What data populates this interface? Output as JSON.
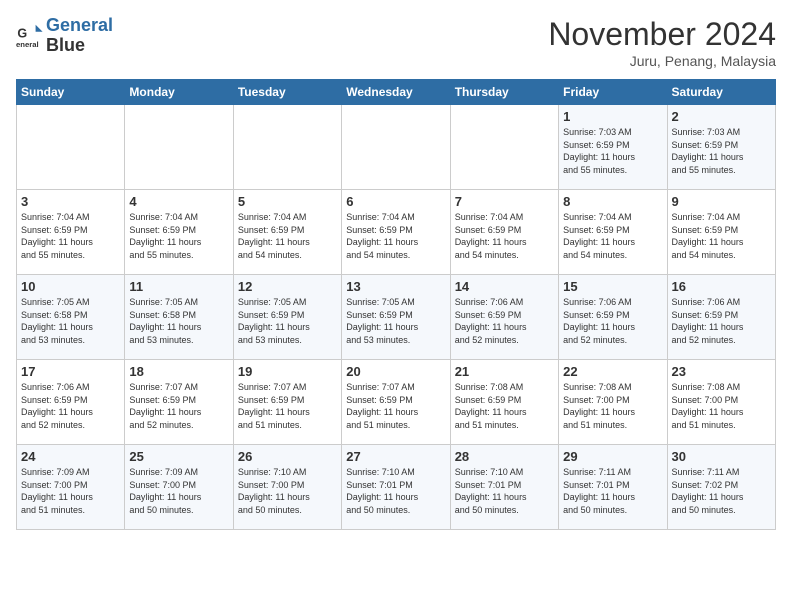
{
  "header": {
    "logo_line1": "General",
    "logo_line2": "Blue",
    "month": "November 2024",
    "location": "Juru, Penang, Malaysia"
  },
  "days_of_week": [
    "Sunday",
    "Monday",
    "Tuesday",
    "Wednesday",
    "Thursday",
    "Friday",
    "Saturday"
  ],
  "weeks": [
    [
      {
        "day": "",
        "info": ""
      },
      {
        "day": "",
        "info": ""
      },
      {
        "day": "",
        "info": ""
      },
      {
        "day": "",
        "info": ""
      },
      {
        "day": "",
        "info": ""
      },
      {
        "day": "1",
        "info": "Sunrise: 7:03 AM\nSunset: 6:59 PM\nDaylight: 11 hours\nand 55 minutes."
      },
      {
        "day": "2",
        "info": "Sunrise: 7:03 AM\nSunset: 6:59 PM\nDaylight: 11 hours\nand 55 minutes."
      }
    ],
    [
      {
        "day": "3",
        "info": "Sunrise: 7:04 AM\nSunset: 6:59 PM\nDaylight: 11 hours\nand 55 minutes."
      },
      {
        "day": "4",
        "info": "Sunrise: 7:04 AM\nSunset: 6:59 PM\nDaylight: 11 hours\nand 55 minutes."
      },
      {
        "day": "5",
        "info": "Sunrise: 7:04 AM\nSunset: 6:59 PM\nDaylight: 11 hours\nand 54 minutes."
      },
      {
        "day": "6",
        "info": "Sunrise: 7:04 AM\nSunset: 6:59 PM\nDaylight: 11 hours\nand 54 minutes."
      },
      {
        "day": "7",
        "info": "Sunrise: 7:04 AM\nSunset: 6:59 PM\nDaylight: 11 hours\nand 54 minutes."
      },
      {
        "day": "8",
        "info": "Sunrise: 7:04 AM\nSunset: 6:59 PM\nDaylight: 11 hours\nand 54 minutes."
      },
      {
        "day": "9",
        "info": "Sunrise: 7:04 AM\nSunset: 6:59 PM\nDaylight: 11 hours\nand 54 minutes."
      }
    ],
    [
      {
        "day": "10",
        "info": "Sunrise: 7:05 AM\nSunset: 6:58 PM\nDaylight: 11 hours\nand 53 minutes."
      },
      {
        "day": "11",
        "info": "Sunrise: 7:05 AM\nSunset: 6:58 PM\nDaylight: 11 hours\nand 53 minutes."
      },
      {
        "day": "12",
        "info": "Sunrise: 7:05 AM\nSunset: 6:59 PM\nDaylight: 11 hours\nand 53 minutes."
      },
      {
        "day": "13",
        "info": "Sunrise: 7:05 AM\nSunset: 6:59 PM\nDaylight: 11 hours\nand 53 minutes."
      },
      {
        "day": "14",
        "info": "Sunrise: 7:06 AM\nSunset: 6:59 PM\nDaylight: 11 hours\nand 52 minutes."
      },
      {
        "day": "15",
        "info": "Sunrise: 7:06 AM\nSunset: 6:59 PM\nDaylight: 11 hours\nand 52 minutes."
      },
      {
        "day": "16",
        "info": "Sunrise: 7:06 AM\nSunset: 6:59 PM\nDaylight: 11 hours\nand 52 minutes."
      }
    ],
    [
      {
        "day": "17",
        "info": "Sunrise: 7:06 AM\nSunset: 6:59 PM\nDaylight: 11 hours\nand 52 minutes."
      },
      {
        "day": "18",
        "info": "Sunrise: 7:07 AM\nSunset: 6:59 PM\nDaylight: 11 hours\nand 52 minutes."
      },
      {
        "day": "19",
        "info": "Sunrise: 7:07 AM\nSunset: 6:59 PM\nDaylight: 11 hours\nand 51 minutes."
      },
      {
        "day": "20",
        "info": "Sunrise: 7:07 AM\nSunset: 6:59 PM\nDaylight: 11 hours\nand 51 minutes."
      },
      {
        "day": "21",
        "info": "Sunrise: 7:08 AM\nSunset: 6:59 PM\nDaylight: 11 hours\nand 51 minutes."
      },
      {
        "day": "22",
        "info": "Sunrise: 7:08 AM\nSunset: 7:00 PM\nDaylight: 11 hours\nand 51 minutes."
      },
      {
        "day": "23",
        "info": "Sunrise: 7:08 AM\nSunset: 7:00 PM\nDaylight: 11 hours\nand 51 minutes."
      }
    ],
    [
      {
        "day": "24",
        "info": "Sunrise: 7:09 AM\nSunset: 7:00 PM\nDaylight: 11 hours\nand 51 minutes."
      },
      {
        "day": "25",
        "info": "Sunrise: 7:09 AM\nSunset: 7:00 PM\nDaylight: 11 hours\nand 50 minutes."
      },
      {
        "day": "26",
        "info": "Sunrise: 7:10 AM\nSunset: 7:00 PM\nDaylight: 11 hours\nand 50 minutes."
      },
      {
        "day": "27",
        "info": "Sunrise: 7:10 AM\nSunset: 7:01 PM\nDaylight: 11 hours\nand 50 minutes."
      },
      {
        "day": "28",
        "info": "Sunrise: 7:10 AM\nSunset: 7:01 PM\nDaylight: 11 hours\nand 50 minutes."
      },
      {
        "day": "29",
        "info": "Sunrise: 7:11 AM\nSunset: 7:01 PM\nDaylight: 11 hours\nand 50 minutes."
      },
      {
        "day": "30",
        "info": "Sunrise: 7:11 AM\nSunset: 7:02 PM\nDaylight: 11 hours\nand 50 minutes."
      }
    ]
  ]
}
